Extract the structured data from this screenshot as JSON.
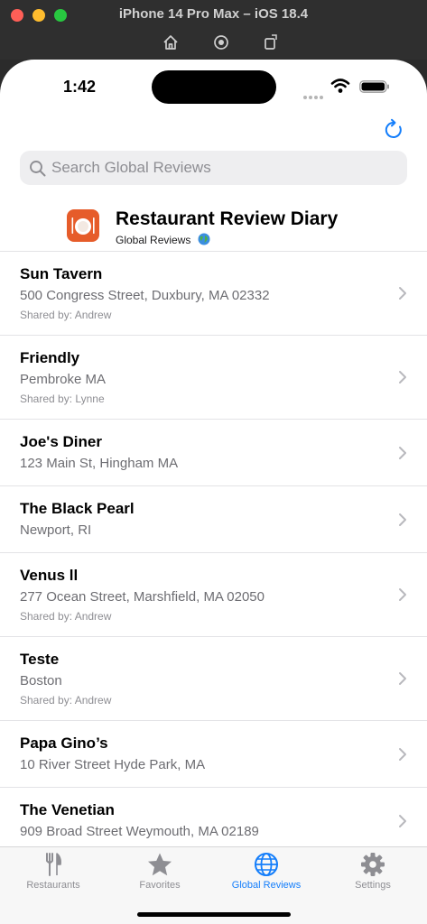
{
  "simulator": {
    "title": "iPhone 14 Pro Max – iOS 18.4",
    "toolbar_icons": [
      "home-icon",
      "screenshot-icon",
      "rotate-icon"
    ]
  },
  "status_bar": {
    "time": "1:42"
  },
  "nav": {
    "refresh_icon": "refresh-icon",
    "accent_color": "#147efb"
  },
  "search": {
    "placeholder": "Search Global Reviews"
  },
  "header": {
    "title": "Restaurant Review Diary",
    "subtitle": "Global Reviews",
    "subtitle_emoji": "globe-icon",
    "icon_color": "#e65c2a"
  },
  "restaurants": [
    {
      "name": "Sun Tavern",
      "address": "500 Congress Street, Duxbury, MA 02332",
      "shared": "Shared by: Andrew"
    },
    {
      "name": "Friendly",
      "address": "Pembroke MA",
      "shared": "Shared by: Lynne"
    },
    {
      "name": "Joe's Diner",
      "address": "123 Main St, Hingham MA",
      "shared": ""
    },
    {
      "name": "The Black Pearl",
      "address": "Newport, RI",
      "shared": ""
    },
    {
      "name": "Venus ll",
      "address": "277 Ocean Street, Marshfield, MA 02050",
      "shared": "Shared by: Andrew"
    },
    {
      "name": "Teste",
      "address": "Boston",
      "shared": "Shared by: Andrew"
    },
    {
      "name": "Papa Gino’s",
      "address": "10 River Street Hyde Park, MA",
      "shared": ""
    },
    {
      "name": "The Venetian",
      "address": "909 Broad Street Weymouth, MA 02189",
      "shared": ""
    }
  ],
  "tabs": [
    {
      "label": "Restaurants",
      "icon": "fork-knife-icon",
      "active": false
    },
    {
      "label": "Favorites",
      "icon": "star-icon",
      "active": false
    },
    {
      "label": "Global Reviews",
      "icon": "globe-icon",
      "active": true
    },
    {
      "label": "Settings",
      "icon": "gear-icon",
      "active": false
    }
  ]
}
